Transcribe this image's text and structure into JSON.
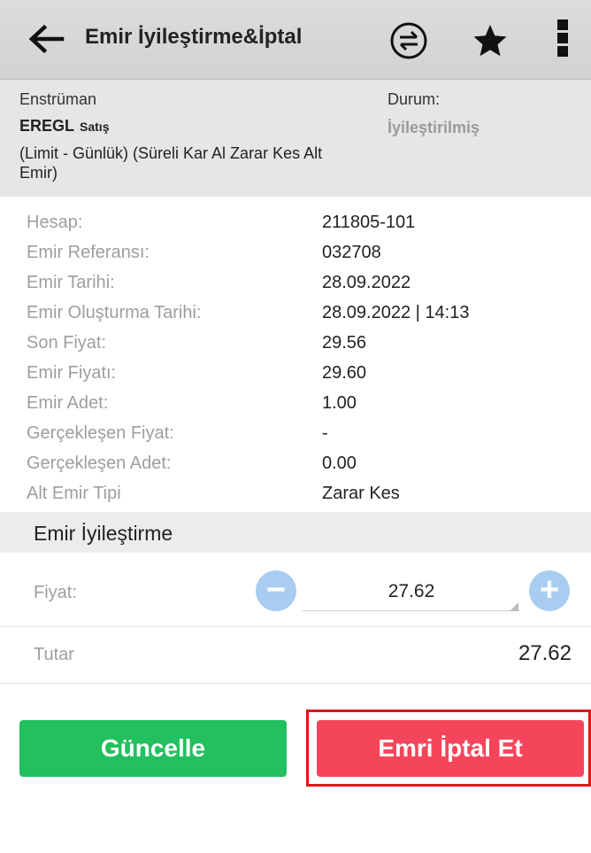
{
  "header": {
    "title": "Emir İyileştirme&İptal",
    "icons": [
      "arrow-left-icon",
      "swap-icon",
      "star-icon",
      "more-vertical-icon"
    ]
  },
  "summary": {
    "instrument_label": "Enstrüman",
    "symbol": "EREGL",
    "side": "Satış",
    "description": "(Limit - Günlük)  (Süreli Kar Al Zarar Kes Alt Emir)",
    "status_label": "Durum:",
    "status": "İyileştirilmiş"
  },
  "details": [
    {
      "label": "Hesap:",
      "value": "211805-101"
    },
    {
      "label": "Emir Referansı:",
      "value": "032708"
    },
    {
      "label": "Emir Tarihi:",
      "value": "28.09.2022"
    },
    {
      "label": "Emir Oluşturma Tarihi:",
      "value": "28.09.2022 | 14:13"
    },
    {
      "label": "Son Fiyat:",
      "value": "29.56"
    },
    {
      "label": "Emir Fiyatı:",
      "value": "29.60"
    },
    {
      "label": "Emir Adet:",
      "value": "1.00"
    },
    {
      "label": "Gerçekleşen Fiyat:",
      "value": "-"
    },
    {
      "label": "Gerçekleşen Adet:",
      "value": "0.00"
    },
    {
      "label": "Alt Emir Tipi",
      "value": "Zarar Kes"
    }
  ],
  "edit": {
    "section_title": "Emir İyileştirme",
    "price_label": "Fiyat:",
    "price_value": "27.62",
    "minus": "−",
    "plus": "+",
    "total_label": "Tutar",
    "total_value": "27.62"
  },
  "actions": {
    "update_label": "Güncelle",
    "cancel_label": "Emri İptal Et"
  },
  "colors": {
    "update": "#22c05e",
    "cancel": "#f5455b",
    "stepper": "#a9cdf1",
    "highlight": "#e01818"
  }
}
